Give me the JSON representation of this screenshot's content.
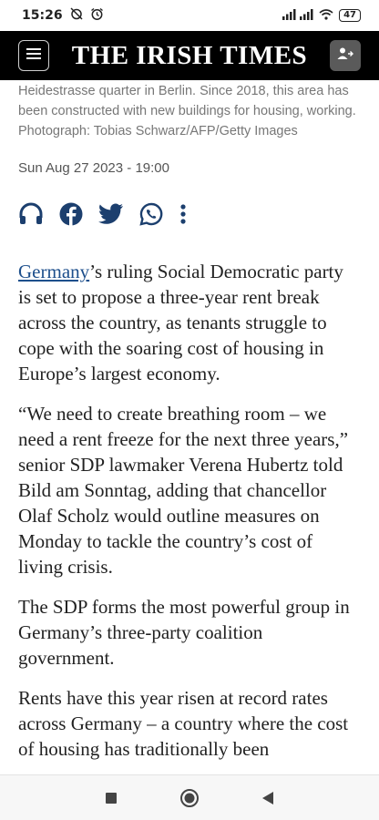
{
  "status_bar": {
    "time": "15:26",
    "battery": "47",
    "icons": [
      "alarm-off-icon",
      "alarm-icon",
      "signal-icon",
      "wifi-icon",
      "battery-icon"
    ]
  },
  "header": {
    "masthead": "THE IRISH TIMES",
    "menu_icon": "menu-icon",
    "account_icon": "account-icon"
  },
  "article": {
    "caption": "Heidestrasse quarter in Berlin. Since 2018, this area has been constructed with new buildings for housing, working. Photograph: Tobias Schwarz/AFP/Getty Images",
    "date": "Sun Aug 27 2023 - 19:00",
    "share_icons": [
      "headphones-icon",
      "facebook-icon",
      "twitter-icon",
      "whatsapp-icon",
      "more-options-icon"
    ],
    "p1_link": "Germany",
    "p1_rest": "’s ruling Social Democratic party is set to propose a three-year rent break across the country, as tenants struggle to cope with the soaring cost of housing in Europe’s largest economy.",
    "p2": "“We need to create breathing room – we need a rent freeze for the next three years,” senior SDP lawmaker Verena Hubertz told Bild am Sonntag, adding that chancellor Olaf Scholz would outline measures on Monday to tackle the country’s cost of living crisis.",
    "p3": "The SDP forms the most powerful group in Germany’s three-party coalition government.",
    "p4": "Rents have this year risen at record rates across Germany – a country where the cost of housing has traditionally been"
  },
  "nav": {
    "icons": [
      "recents-icon",
      "home-icon",
      "back-icon"
    ]
  },
  "colors": {
    "header_bg": "#000000",
    "link": "#1d4f8c",
    "share_icon": "#1c3f6e",
    "caption": "#777777"
  }
}
